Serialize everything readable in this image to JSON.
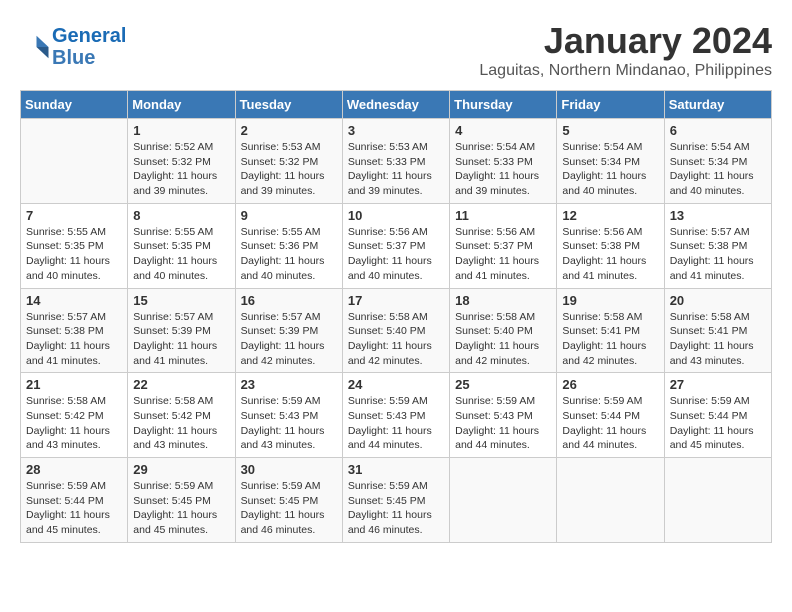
{
  "header": {
    "logo_line1": "General",
    "logo_line2": "Blue",
    "month": "January 2024",
    "location": "Laguitas, Northern Mindanao, Philippines"
  },
  "weekdays": [
    "Sunday",
    "Monday",
    "Tuesday",
    "Wednesday",
    "Thursday",
    "Friday",
    "Saturday"
  ],
  "weeks": [
    [
      {
        "day": "",
        "info": ""
      },
      {
        "day": "1",
        "info": "Sunrise: 5:52 AM\nSunset: 5:32 PM\nDaylight: 11 hours\nand 39 minutes."
      },
      {
        "day": "2",
        "info": "Sunrise: 5:53 AM\nSunset: 5:32 PM\nDaylight: 11 hours\nand 39 minutes."
      },
      {
        "day": "3",
        "info": "Sunrise: 5:53 AM\nSunset: 5:33 PM\nDaylight: 11 hours\nand 39 minutes."
      },
      {
        "day": "4",
        "info": "Sunrise: 5:54 AM\nSunset: 5:33 PM\nDaylight: 11 hours\nand 39 minutes."
      },
      {
        "day": "5",
        "info": "Sunrise: 5:54 AM\nSunset: 5:34 PM\nDaylight: 11 hours\nand 40 minutes."
      },
      {
        "day": "6",
        "info": "Sunrise: 5:54 AM\nSunset: 5:34 PM\nDaylight: 11 hours\nand 40 minutes."
      }
    ],
    [
      {
        "day": "7",
        "info": "Sunrise: 5:55 AM\nSunset: 5:35 PM\nDaylight: 11 hours\nand 40 minutes."
      },
      {
        "day": "8",
        "info": "Sunrise: 5:55 AM\nSunset: 5:35 PM\nDaylight: 11 hours\nand 40 minutes."
      },
      {
        "day": "9",
        "info": "Sunrise: 5:55 AM\nSunset: 5:36 PM\nDaylight: 11 hours\nand 40 minutes."
      },
      {
        "day": "10",
        "info": "Sunrise: 5:56 AM\nSunset: 5:37 PM\nDaylight: 11 hours\nand 40 minutes."
      },
      {
        "day": "11",
        "info": "Sunrise: 5:56 AM\nSunset: 5:37 PM\nDaylight: 11 hours\nand 41 minutes."
      },
      {
        "day": "12",
        "info": "Sunrise: 5:56 AM\nSunset: 5:38 PM\nDaylight: 11 hours\nand 41 minutes."
      },
      {
        "day": "13",
        "info": "Sunrise: 5:57 AM\nSunset: 5:38 PM\nDaylight: 11 hours\nand 41 minutes."
      }
    ],
    [
      {
        "day": "14",
        "info": "Sunrise: 5:57 AM\nSunset: 5:38 PM\nDaylight: 11 hours\nand 41 minutes."
      },
      {
        "day": "15",
        "info": "Sunrise: 5:57 AM\nSunset: 5:39 PM\nDaylight: 11 hours\nand 41 minutes."
      },
      {
        "day": "16",
        "info": "Sunrise: 5:57 AM\nSunset: 5:39 PM\nDaylight: 11 hours\nand 42 minutes."
      },
      {
        "day": "17",
        "info": "Sunrise: 5:58 AM\nSunset: 5:40 PM\nDaylight: 11 hours\nand 42 minutes."
      },
      {
        "day": "18",
        "info": "Sunrise: 5:58 AM\nSunset: 5:40 PM\nDaylight: 11 hours\nand 42 minutes."
      },
      {
        "day": "19",
        "info": "Sunrise: 5:58 AM\nSunset: 5:41 PM\nDaylight: 11 hours\nand 42 minutes."
      },
      {
        "day": "20",
        "info": "Sunrise: 5:58 AM\nSunset: 5:41 PM\nDaylight: 11 hours\nand 43 minutes."
      }
    ],
    [
      {
        "day": "21",
        "info": "Sunrise: 5:58 AM\nSunset: 5:42 PM\nDaylight: 11 hours\nand 43 minutes."
      },
      {
        "day": "22",
        "info": "Sunrise: 5:58 AM\nSunset: 5:42 PM\nDaylight: 11 hours\nand 43 minutes."
      },
      {
        "day": "23",
        "info": "Sunrise: 5:59 AM\nSunset: 5:43 PM\nDaylight: 11 hours\nand 43 minutes."
      },
      {
        "day": "24",
        "info": "Sunrise: 5:59 AM\nSunset: 5:43 PM\nDaylight: 11 hours\nand 44 minutes."
      },
      {
        "day": "25",
        "info": "Sunrise: 5:59 AM\nSunset: 5:43 PM\nDaylight: 11 hours\nand 44 minutes."
      },
      {
        "day": "26",
        "info": "Sunrise: 5:59 AM\nSunset: 5:44 PM\nDaylight: 11 hours\nand 44 minutes."
      },
      {
        "day": "27",
        "info": "Sunrise: 5:59 AM\nSunset: 5:44 PM\nDaylight: 11 hours\nand 45 minutes."
      }
    ],
    [
      {
        "day": "28",
        "info": "Sunrise: 5:59 AM\nSunset: 5:44 PM\nDaylight: 11 hours\nand 45 minutes."
      },
      {
        "day": "29",
        "info": "Sunrise: 5:59 AM\nSunset: 5:45 PM\nDaylight: 11 hours\nand 45 minutes."
      },
      {
        "day": "30",
        "info": "Sunrise: 5:59 AM\nSunset: 5:45 PM\nDaylight: 11 hours\nand 46 minutes."
      },
      {
        "day": "31",
        "info": "Sunrise: 5:59 AM\nSunset: 5:45 PM\nDaylight: 11 hours\nand 46 minutes."
      },
      {
        "day": "",
        "info": ""
      },
      {
        "day": "",
        "info": ""
      },
      {
        "day": "",
        "info": ""
      }
    ]
  ]
}
